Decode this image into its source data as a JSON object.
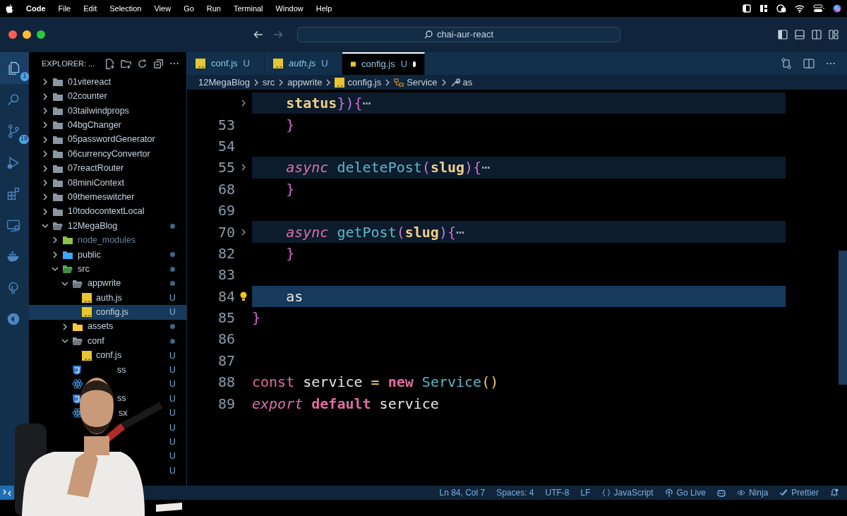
{
  "menu_bar": {
    "app": "Code",
    "items": [
      "File",
      "Edit",
      "Selection",
      "View",
      "Go",
      "Run",
      "Terminal",
      "Window",
      "Help"
    ]
  },
  "title_bar": {
    "search": "chai-aur-react"
  },
  "activity_bar": [
    {
      "kind": "files",
      "badge": "1",
      "selected": true
    },
    {
      "kind": "search",
      "selected": false
    },
    {
      "kind": "scm",
      "badge": "19",
      "selected": false
    },
    {
      "kind": "debug",
      "selected": false
    },
    {
      "kind": "extensions",
      "selected": false
    },
    {
      "kind": "remote",
      "selected": false
    },
    {
      "kind": "docker",
      "selected": false
    },
    {
      "kind": "pin",
      "selected": false
    },
    {
      "kind": "chart",
      "selected": false
    }
  ],
  "sidebar": {
    "title": "EXPLORER: ...",
    "more": "⋯",
    "items": [
      {
        "label": "01vitereact",
        "kind": "folder",
        "color": "#8a96a3",
        "expanded": false,
        "dot": false,
        "selected": false
      },
      {
        "label": "02counter",
        "kind": "folder",
        "color": "#8a96a3",
        "expanded": false,
        "dot": false,
        "selected": false
      },
      {
        "label": "03tailwindprops",
        "kind": "folder",
        "color": "#8a96a3",
        "expanded": false,
        "dot": false,
        "selected": false
      },
      {
        "label": "04bgChanger",
        "kind": "folder",
        "color": "#8a96a3",
        "expanded": false,
        "dot": false,
        "selected": false
      },
      {
        "label": "05passwordGenerator",
        "kind": "folder",
        "color": "#8a96a3",
        "expanded": false,
        "dot": false,
        "selected": false
      },
      {
        "label": "06currencyConvertor",
        "kind": "folder",
        "color": "#8a96a3",
        "expanded": false,
        "dot": false,
        "selected": false
      },
      {
        "label": "07reactRouter",
        "kind": "folder",
        "color": "#8a96a3",
        "expanded": false,
        "dot": false,
        "selected": false
      },
      {
        "label": "08miniContext",
        "kind": "folder",
        "color": "#8a96a3",
        "expanded": false,
        "dot": false,
        "selected": false
      },
      {
        "label": "09themeswitcher",
        "kind": "folder",
        "color": "#8a96a3",
        "expanded": false,
        "dot": false,
        "selected": false
      },
      {
        "label": "10todocontextLocal",
        "kind": "folder",
        "color": "#8a96a3",
        "expanded": false,
        "dot": false,
        "selected": false
      },
      {
        "label": "12MegaBlog",
        "kind": "folder",
        "color": "#8a96a3",
        "expanded": true,
        "dot": true,
        "selected": false,
        "children": [
          {
            "label": "node_modules",
            "kind": "folder",
            "color": "#8bc34a",
            "expanded": false,
            "dot": false,
            "dimmed": true,
            "selected": false
          },
          {
            "label": "public",
            "kind": "folder",
            "color": "#42a5f5",
            "expanded": false,
            "dot": true,
            "selected": false
          },
          {
            "label": "src",
            "kind": "folder",
            "color": "#4caf50",
            "expanded": true,
            "dot": true,
            "selected": false,
            "children": [
              {
                "label": "appwrite",
                "kind": "folder",
                "color": "#8a96a3",
                "expanded": true,
                "dot": true,
                "selected": false,
                "children": [
                  {
                    "label": "auth.js",
                    "kind": "js",
                    "badge": "U",
                    "selected": false
                  },
                  {
                    "label": "config.js",
                    "kind": "js",
                    "badge": "U",
                    "selected": true
                  }
                ]
              },
              {
                "label": "assets",
                "kind": "folder",
                "color": "#f9c846",
                "expanded": false,
                "dot": true,
                "selected": false
              },
              {
                "label": "conf",
                "kind": "folder",
                "color": "#8a96a3",
                "expanded": true,
                "dot": true,
                "selected": false,
                "children": [
                  {
                    "label": "conf.js",
                    "kind": "js",
                    "badge": "U",
                    "selected": false
                  }
                ]
              },
              {
                "label": "ss",
                "kind": "css",
                "badge": "U",
                "selected": false
              },
              {
                "kind": "react",
                "badge": "U",
                "selected": false
              },
              {
                "label": "ss",
                "kind": "css",
                "badge": "U",
                "selected": false
              },
              {
                "label": "sx",
                "kind": "react",
                "badge": "U",
                "selected": false
              }
            ]
          }
        ]
      },
      {
        "kind": "hidden",
        "badge": "U",
        "selected": false
      },
      {
        "kind": "hidden",
        "badge": "U",
        "selected": false
      },
      {
        "kind": "hidden",
        "badge": "U",
        "selected": false
      },
      {
        "kind": "hidden",
        "badge": "U",
        "selected": false
      }
    ]
  },
  "tabs": [
    {
      "label": "conf.js",
      "badge": "U",
      "preview": false,
      "selected": false,
      "dirty": false
    },
    {
      "label": "auth.js",
      "badge": "U",
      "preview": true,
      "selected": false,
      "dirty": false
    },
    {
      "label": "config.js",
      "badge": "U",
      "preview": false,
      "selected": true,
      "dirty": true
    }
  ],
  "editor_actions": {
    "more": "⋯"
  },
  "breadcrumbs": [
    {
      "label": "12MegaBlog",
      "kind": "folder"
    },
    {
      "label": "src",
      "kind": "folder"
    },
    {
      "label": "appwrite",
      "kind": "folder"
    },
    {
      "label": "config.js",
      "kind": "js"
    },
    {
      "label": "Service",
      "kind": "class"
    },
    {
      "label": "as",
      "kind": "property"
    }
  ],
  "editor": {
    "lines": [
      {
        "folded": true,
        "current": false,
        "tokens": [
          {
            "text": "    status",
            "kind": "param"
          },
          {
            "text": "})",
            "kind": "punct"
          },
          {
            "text": "{",
            "kind": "brace"
          },
          {
            "text": "⋯",
            "kind": "ellipsis"
          }
        ]
      },
      {
        "number": "53",
        "folded": false,
        "current": false,
        "tokens": [
          {
            "text": "    }",
            "kind": "brace"
          }
        ]
      },
      {
        "number": "54",
        "folded": false,
        "current": false
      },
      {
        "number": "55",
        "folded": true,
        "current": false,
        "tokens": [
          {
            "text": "    async",
            "kind": "keyword_italic"
          },
          {
            "text": " deletePost",
            "kind": "function"
          },
          {
            "text": "(",
            "kind": "punct"
          },
          {
            "text": "slug",
            "kind": "param"
          },
          {
            "text": ")",
            "kind": "punct"
          },
          {
            "text": "{",
            "kind": "brace"
          },
          {
            "text": "⋯",
            "kind": "ellipsis"
          }
        ]
      },
      {
        "number": "68",
        "folded": false,
        "current": false,
        "tokens": [
          {
            "text": "    }",
            "kind": "brace"
          }
        ]
      },
      {
        "number": "69",
        "folded": false,
        "current": false
      },
      {
        "number": "70",
        "folded": true,
        "current": false,
        "tokens": [
          {
            "text": "    async",
            "kind": "keyword_italic"
          },
          {
            "text": " getPost",
            "kind": "function"
          },
          {
            "text": "(",
            "kind": "punct"
          },
          {
            "text": "slug",
            "kind": "param"
          },
          {
            "text": ")",
            "kind": "punct"
          },
          {
            "text": "{",
            "kind": "brace"
          },
          {
            "text": "⋯",
            "kind": "ellipsis"
          }
        ]
      },
      {
        "number": "82",
        "folded": false,
        "current": false,
        "tokens": [
          {
            "text": "    }",
            "kind": "brace"
          }
        ]
      },
      {
        "number": "83",
        "folded": false,
        "current": false
      },
      {
        "number": "84",
        "folded": false,
        "current": true,
        "tokens": [
          {
            "text": "    as",
            "kind": "plain"
          }
        ]
      },
      {
        "number": "85",
        "folded": false,
        "current": false,
        "tokens": [
          {
            "text": "}",
            "kind": "brace"
          }
        ]
      },
      {
        "number": "86",
        "folded": false,
        "current": false
      },
      {
        "number": "87",
        "folded": false,
        "current": false
      },
      {
        "number": "88",
        "folded": false,
        "current": false,
        "tokens": [
          {
            "text": "const",
            "kind": "keyword"
          },
          {
            "text": " service ",
            "kind": "plain"
          },
          {
            "text": "=",
            "kind": "operator"
          },
          {
            "text": " new",
            "kind": "keyword_bold"
          },
          {
            "text": " Service",
            "kind": "function"
          },
          {
            "text": "()",
            "kind": "operator"
          }
        ]
      },
      {
        "number": "89",
        "folded": false,
        "current": false,
        "tokens": [
          {
            "text": "export",
            "kind": "keyword_italic"
          },
          {
            "text": " default",
            "kind": "keyword_bold"
          },
          {
            "text": " service",
            "kind": "plain"
          }
        ]
      }
    ]
  },
  "status_bar": {
    "left": [
      {
        "kind": "remote"
      }
    ],
    "right": [
      {
        "label": "Ln 84, Col 7",
        "kind": "text"
      },
      {
        "label": "Spaces: 4",
        "kind": "text"
      },
      {
        "label": "UTF-8",
        "kind": "text"
      },
      {
        "label": "LF",
        "kind": "text"
      },
      {
        "label": "JavaScript",
        "kind": "braces"
      },
      {
        "label": "Go Live",
        "kind": "broadcast"
      },
      {
        "kind": "copilot"
      },
      {
        "label": "Ninja",
        "kind": "eye"
      },
      {
        "label": "Prettier",
        "kind": "check"
      },
      {
        "kind": "bell"
      }
    ]
  }
}
